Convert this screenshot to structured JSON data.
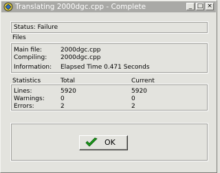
{
  "window": {
    "title": "Translating 2000dgc.cpp - Complete"
  },
  "status": {
    "text": "Status: Failure"
  },
  "files": {
    "heading": "Files",
    "rows": [
      {
        "label": "Main file:",
        "value": "2000dgc.cpp"
      },
      {
        "label": "Compiling:",
        "value": "2000dgc.cpp"
      },
      {
        "label": "Information:",
        "value": "Elapsed Time 0.471 Seconds"
      }
    ]
  },
  "statistics": {
    "headers": [
      "Statistics",
      "Total",
      "Current"
    ],
    "rows": [
      {
        "label": "Lines:",
        "total": "5920",
        "current": "5920"
      },
      {
        "label": "Warnings:",
        "total": "0",
        "current": "0"
      },
      {
        "label": "Errors:",
        "total": "2",
        "current": "2"
      }
    ]
  },
  "ok_button": {
    "label": "OK"
  },
  "icons": {
    "app": "compiler-app-icon",
    "check": "green-checkmark-icon"
  },
  "colors": {
    "titlebar": "#a9a9a6",
    "face": "#e3e3de",
    "check": "#1a9a1a"
  }
}
